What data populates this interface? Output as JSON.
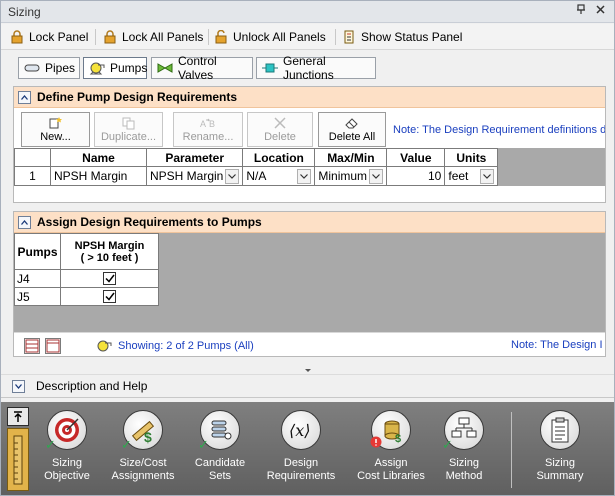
{
  "window": {
    "title": "Sizing",
    "buttons": [
      "pin",
      "close"
    ]
  },
  "toolbar": {
    "lock_panel": "Lock Panel",
    "lock_all_panels": "Lock All Panels",
    "unlock_all_panels": "Unlock All Panels",
    "show_status_panel": "Show Status Panel"
  },
  "tabs": [
    {
      "label": "Pipes",
      "icon": "pipe-icon",
      "active": false
    },
    {
      "label": "Pumps",
      "icon": "pump-icon",
      "active": true
    },
    {
      "label": "Control Valves",
      "icon": "valve-icon",
      "active": false
    },
    {
      "label": "General Junctions",
      "icon": "junction-icon",
      "active": false
    }
  ],
  "define_panel": {
    "title": "Define Pump Design Requirements",
    "buttons": {
      "new": "New...",
      "duplicate": "Duplicate...",
      "rename": "Rename...",
      "delete": "Delete",
      "delete_all": "Delete All"
    },
    "note": "Note: The Design Requirement definitions d",
    "columns": [
      "Name",
      "Parameter",
      "Location",
      "Max/Min",
      "Value",
      "Units"
    ],
    "rows": [
      {
        "num": "1",
        "name": "NPSH Margin",
        "parameter": "NPSH Margin",
        "location": "N/A",
        "maxmin": "Minimum",
        "value": "10",
        "units": "feet"
      }
    ]
  },
  "assign_panel": {
    "title": "Assign Design Requirements to Pumps",
    "row_header": "Pumps",
    "column_header_line1": "NPSH Margin",
    "column_header_line2": "( > 10 feet )",
    "rows": [
      {
        "pump": "J4",
        "checked": true
      },
      {
        "pump": "J5",
        "checked": true
      }
    ],
    "showing": "Showing: 2 of 2 Pumps (All)",
    "note": "Note: The Design I"
  },
  "description": {
    "label": "Description and Help"
  },
  "steps": [
    {
      "line1": "Sizing",
      "line2": "Objective",
      "icon": "target-icon",
      "status": "check"
    },
    {
      "line1": "Size/Cost",
      "line2": "Assignments",
      "icon": "ruler-dollar-icon",
      "status": "check"
    },
    {
      "line1": "Candidate",
      "line2": "Sets",
      "icon": "stack-icon",
      "status": "check"
    },
    {
      "line1": "Design",
      "line2": "Requirements",
      "icon": "function-icon",
      "status": "none"
    },
    {
      "line1": "Assign",
      "line2": "Cost Libraries",
      "icon": "coins-icon",
      "status": "warning"
    },
    {
      "line1": "Sizing",
      "line2": "Method",
      "icon": "flowchart-icon",
      "status": "check"
    },
    {
      "line1": "Sizing",
      "line2": "Summary",
      "icon": "clipboard-icon",
      "status": "none"
    }
  ],
  "colors": {
    "panel_header": "#fde0c6",
    "link_blue": "#1a3fbf",
    "bottom_bar": "#6f6f6f",
    "check_green": "#2fa84f"
  }
}
